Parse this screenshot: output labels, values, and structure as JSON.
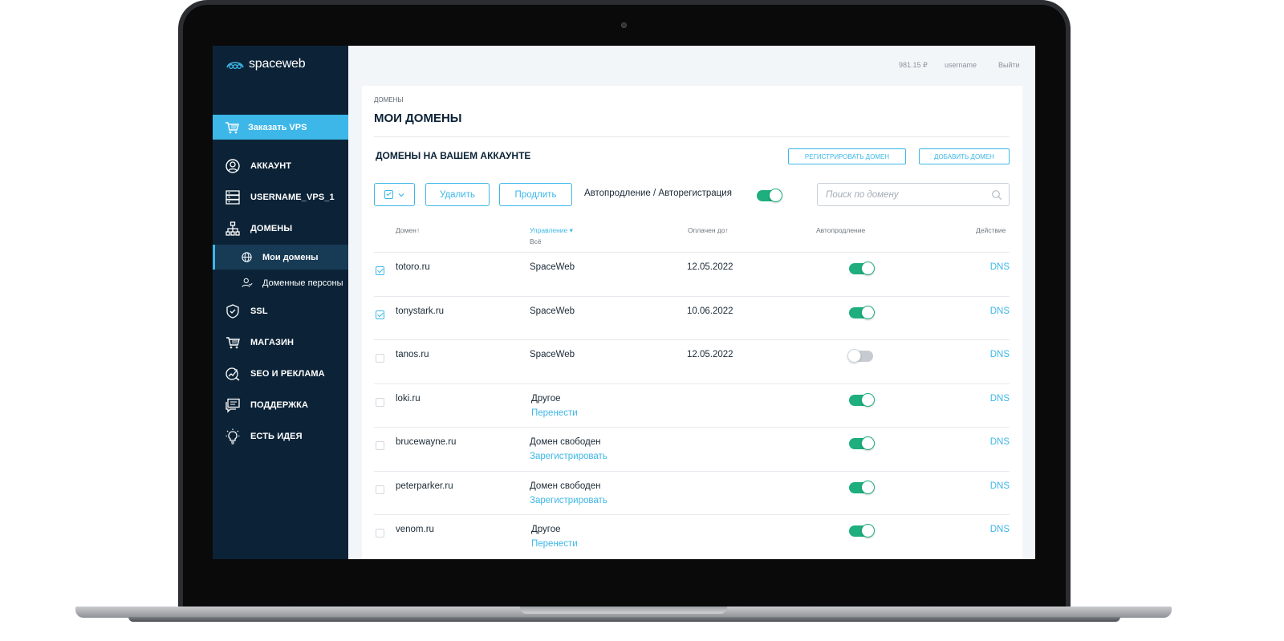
{
  "app": {
    "logo_text": "spaceweb"
  },
  "sidebar": {
    "order_button": "Заказать VPS",
    "items": [
      {
        "label": "АККАУНТ",
        "icon": "user-circle-icon"
      },
      {
        "label": "USERNAME_VPS_1",
        "icon": "server-icon"
      },
      {
        "label": "ДОМЕНЫ",
        "icon": "sitemap-icon"
      },
      {
        "label": "SSL",
        "icon": "shield-check-icon"
      },
      {
        "label": "МАГАЗИН",
        "icon": "cart-icon"
      },
      {
        "label": "SEO И РЕКЛАМА",
        "icon": "chart-search-icon"
      },
      {
        "label": "ПОДДЕРЖКА",
        "icon": "chat-icon"
      },
      {
        "label": "ЕСТЬ ИДЕЯ",
        "icon": "lightbulb-icon"
      }
    ],
    "sub_items": [
      {
        "label": "Мои домены",
        "icon": "globe-icon",
        "active": true
      },
      {
        "label": "Доменные персоны",
        "icon": "person-icon",
        "active": false
      }
    ]
  },
  "header": {
    "balance": "981.15 ₽",
    "username": "username",
    "logout": "Выйти"
  },
  "page": {
    "breadcrumb": "ДОМЕНЫ",
    "title": "МОИ ДОМЕНЫ",
    "section_title": "ДОМЕНЫ НА ВАШЕМ АККАУНТЕ",
    "register_button": "РЕГИСТРИРОВАТЬ ДОМЕН",
    "add_button": "ДОБАВИТЬ ДОМЕН"
  },
  "toolbar": {
    "delete_label": "Удалить",
    "renew_label": "Продлить",
    "auto_label": "Автопродление / Авторегистрация",
    "auto_enabled": true,
    "search_placeholder": "Поиск по домену"
  },
  "table": {
    "columns": {
      "domain": "Домен↑",
      "management": "Управление ▾",
      "management_filter": "Всё",
      "paid_until": "Оплачен до↑",
      "autorenew": "Автопродление",
      "action": "Действие"
    },
    "rows": [
      {
        "checked": true,
        "domain": "totoro.ru",
        "management": "SpaceWeb",
        "management_link": "",
        "paid_until": "12.05.2022",
        "autorenew": true,
        "action": "DNS"
      },
      {
        "checked": true,
        "domain": "tonystark.ru",
        "management": "SpaceWeb",
        "management_link": "",
        "paid_until": "10.06.2022",
        "autorenew": true,
        "action": "DNS"
      },
      {
        "checked": false,
        "domain": "tanos.ru",
        "management": "SpaceWeb",
        "management_link": "",
        "paid_until": "12.05.2022",
        "autorenew": false,
        "action": "DNS"
      },
      {
        "checked": false,
        "domain": "loki.ru",
        "management": "Другое",
        "management_link": "Перенести",
        "paid_until": "",
        "autorenew": true,
        "action": "DNS"
      },
      {
        "checked": false,
        "domain": "brucewayne.ru",
        "management": "Домен свободен",
        "management_link": "Зарегистрировать",
        "paid_until": "",
        "autorenew": true,
        "action": "DNS"
      },
      {
        "checked": false,
        "domain": "peterparker.ru",
        "management": "Домен свободен",
        "management_link": "Зарегистрировать",
        "paid_until": "",
        "autorenew": true,
        "action": "DNS"
      },
      {
        "checked": false,
        "domain": "venom.ru",
        "management": "Другое",
        "management_link": "Перенести",
        "paid_until": "",
        "autorenew": true,
        "action": "DNS"
      }
    ]
  },
  "colors": {
    "sidebar": "#0c2337",
    "accent": "#3db7e8",
    "toggle_on": "#1fae7e"
  }
}
